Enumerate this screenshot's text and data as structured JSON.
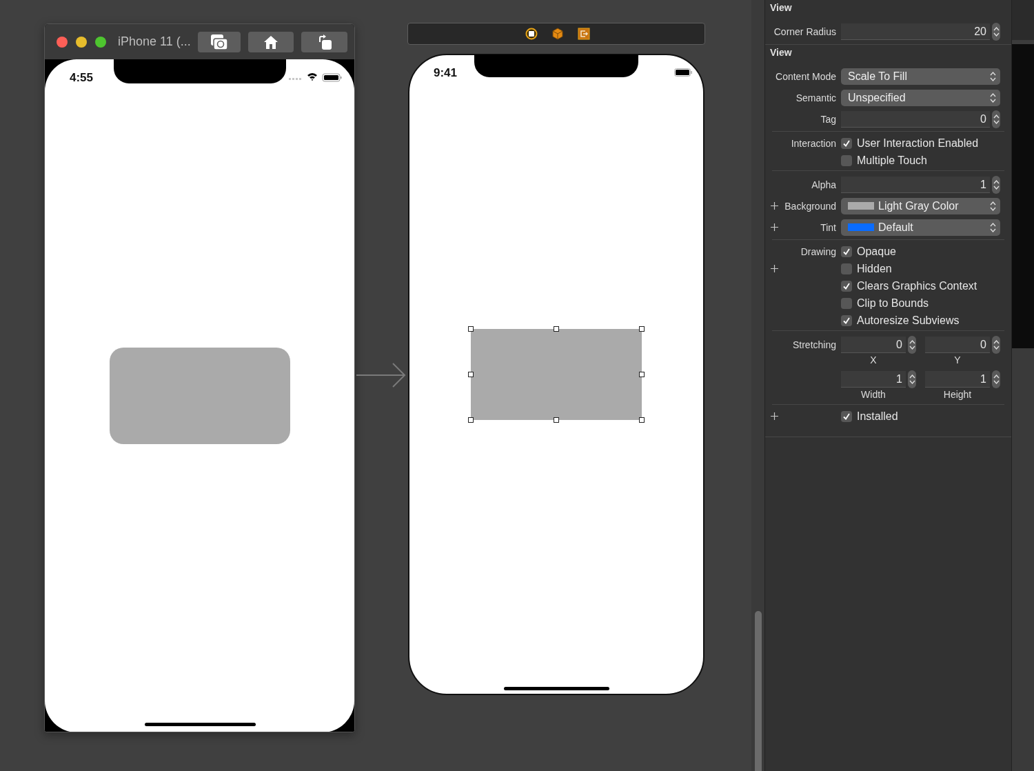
{
  "simulator": {
    "title": "iPhone 11 (...",
    "status_time": "4:55"
  },
  "storyboard": {
    "status_time": "9:41",
    "view": {
      "selected": true
    }
  },
  "inspector": {
    "sections": [
      {
        "title": "View",
        "rows": [
          {
            "kind": "stepper",
            "label": "Corner Radius",
            "value": "20"
          }
        ]
      },
      {
        "title": "View",
        "rows": [
          {
            "kind": "popup",
            "label": "Content Mode",
            "value": "Scale To Fill"
          },
          {
            "kind": "popup",
            "label": "Semantic",
            "value": "Unspecified"
          },
          {
            "kind": "stepper",
            "label": "Tag",
            "value": "0"
          },
          {
            "kind": "divider"
          },
          {
            "kind": "checkbox",
            "label": "Interaction",
            "text": "User Interaction Enabled",
            "checked": true
          },
          {
            "kind": "checkbox",
            "text": "Multiple Touch",
            "checked": false
          },
          {
            "kind": "divider"
          },
          {
            "kind": "stepper",
            "label": "Alpha",
            "value": "1"
          },
          {
            "kind": "popup",
            "label": "Background",
            "value": "Light Gray Color",
            "color": "#aaaaaa",
            "plus": true
          },
          {
            "kind": "popup",
            "label": "Tint",
            "value": "Default",
            "color": "#0a6cff",
            "plus": true
          },
          {
            "kind": "divider"
          },
          {
            "kind": "checkbox",
            "label": "Drawing",
            "text": "Opaque",
            "checked": true
          },
          {
            "kind": "checkbox",
            "text": "Hidden",
            "checked": false,
            "plus": true
          },
          {
            "kind": "checkbox",
            "text": "Clears Graphics Context",
            "checked": true
          },
          {
            "kind": "checkbox",
            "text": "Clip to Bounds",
            "checked": false
          },
          {
            "kind": "checkbox",
            "text": "Autoresize Subviews",
            "checked": true
          },
          {
            "kind": "divider"
          },
          {
            "kind": "pair",
            "label": "Stretching",
            "fields": [
              {
                "value": "0",
                "caption": "X"
              },
              {
                "value": "0",
                "caption": "Y"
              }
            ]
          },
          {
            "kind": "pair",
            "fields": [
              {
                "value": "1",
                "caption": "Width"
              },
              {
                "value": "1",
                "caption": "Height"
              }
            ]
          },
          {
            "kind": "divider"
          },
          {
            "kind": "checkbox",
            "text": "Installed",
            "checked": true,
            "plus": true
          }
        ]
      }
    ]
  }
}
